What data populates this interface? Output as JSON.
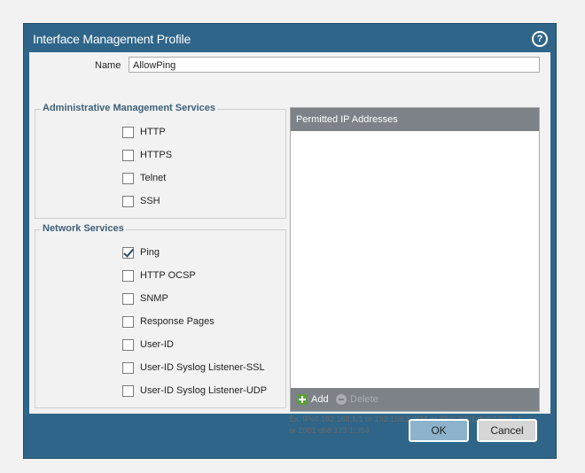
{
  "dialog": {
    "title": "Interface Management Profile",
    "help_icon_glyph": "?"
  },
  "name": {
    "label": "Name",
    "value": "AllowPing"
  },
  "admin_services": {
    "legend": "Administrative Management Services",
    "items": [
      {
        "label": "HTTP",
        "checked": false
      },
      {
        "label": "HTTPS",
        "checked": false
      },
      {
        "label": "Telnet",
        "checked": false
      },
      {
        "label": "SSH",
        "checked": false
      }
    ]
  },
  "network_services": {
    "legend": "Network Services",
    "items": [
      {
        "label": "Ping",
        "checked": true
      },
      {
        "label": "HTTP OCSP",
        "checked": false
      },
      {
        "label": "SNMP",
        "checked": false
      },
      {
        "label": "Response Pages",
        "checked": false
      },
      {
        "label": "User-ID",
        "checked": false
      },
      {
        "label": "User-ID Syslog Listener-SSL",
        "checked": false
      },
      {
        "label": "User-ID Syslog Listener-UDP",
        "checked": false
      }
    ]
  },
  "permitted_ip": {
    "header": "Permitted IP Addresses",
    "add_label": "Add",
    "delete_label": "Delete",
    "hint_line1": "Ex. IPv4 192.168.1.1 or 192.168.1.0/24 or IPv6 2001:db8:123:1::1",
    "hint_line2": "or 2001:db8:123:1::/64"
  },
  "buttons": {
    "ok": "OK",
    "cancel": "Cancel"
  },
  "colors": {
    "titlebar": "#2e6588",
    "grid_header": "#7c8288",
    "ok_button": "#8db3cc"
  }
}
